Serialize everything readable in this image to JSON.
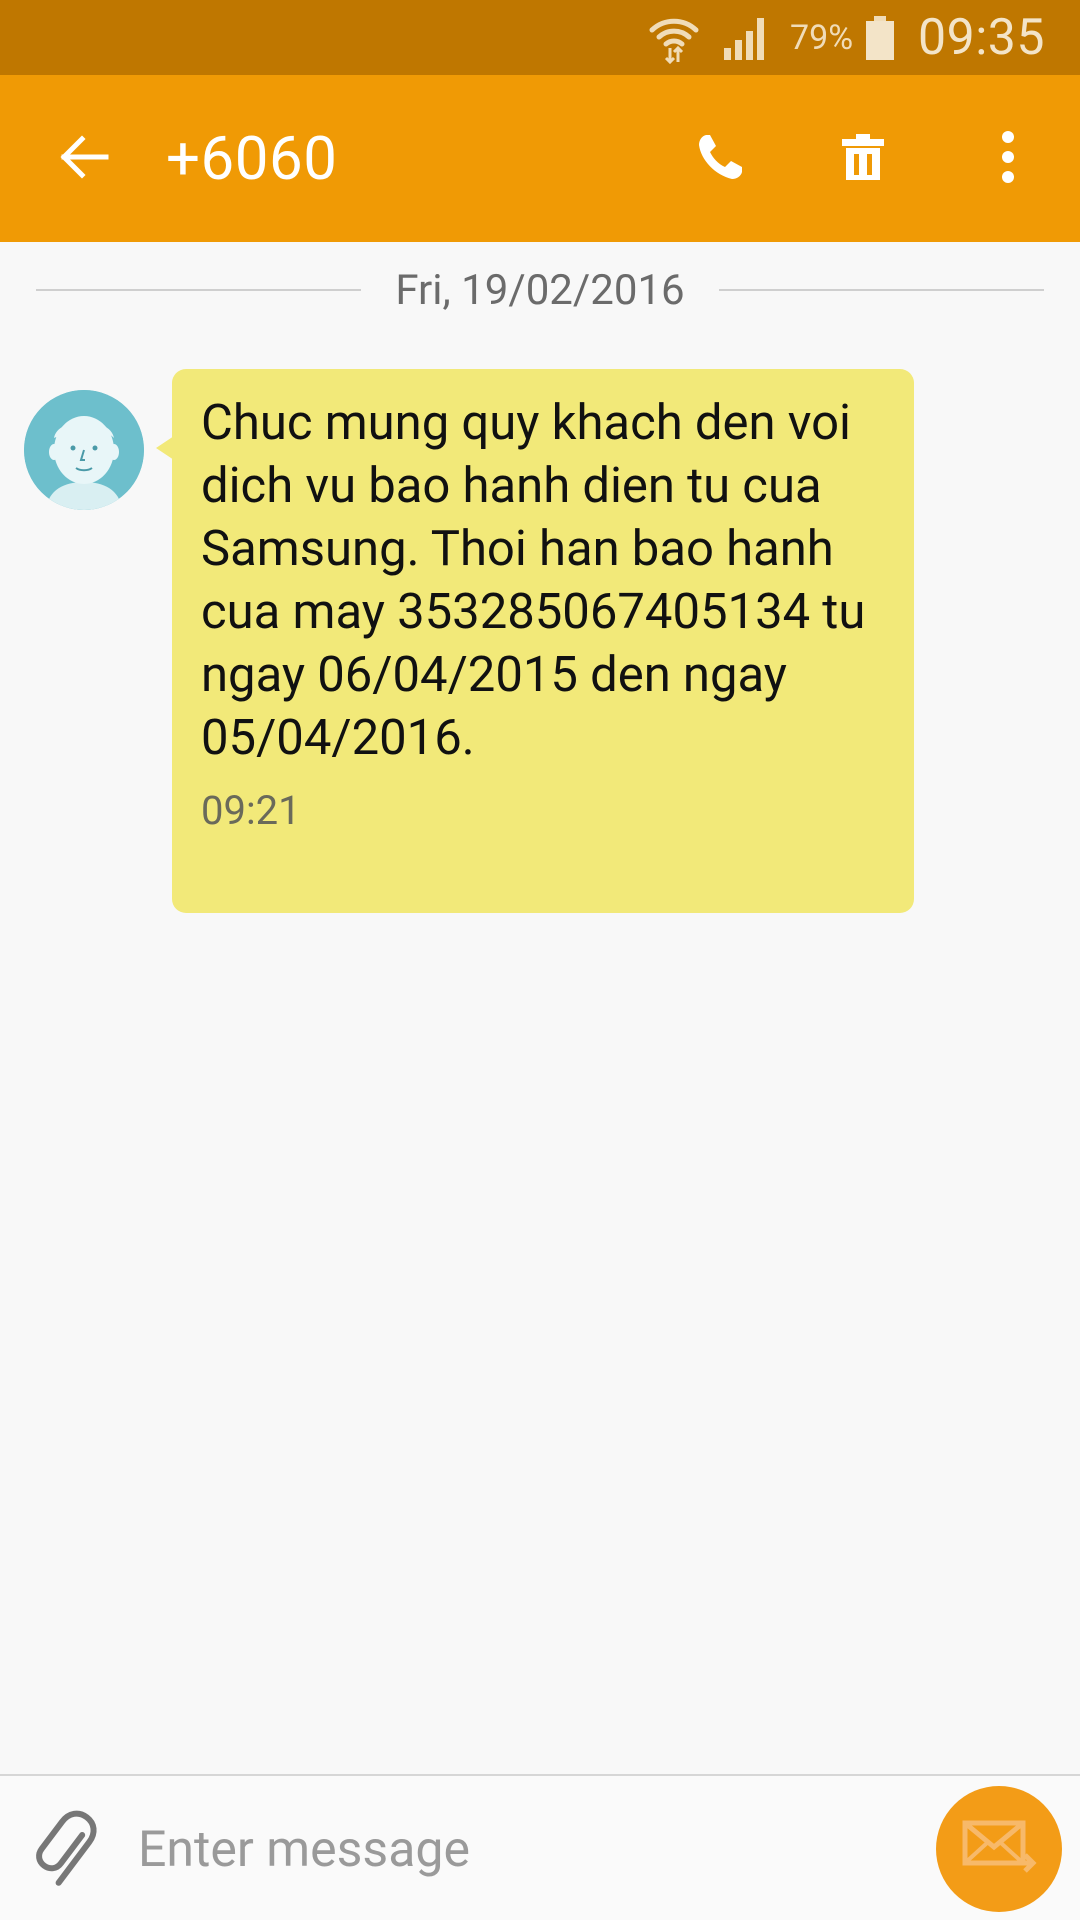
{
  "status_bar": {
    "battery_percent": "79%",
    "time": "09:35",
    "icons": [
      "wifi-icon",
      "signal-icon",
      "battery-icon"
    ]
  },
  "app_bar": {
    "title": "+6060",
    "icons": [
      "back-arrow-icon",
      "phone-icon",
      "trash-icon",
      "more-vert-icon"
    ]
  },
  "conversation": {
    "date": "Fri, 19/02/2016",
    "messages": [
      {
        "text": "Chuc mung quy khach den voi dich vu bao hanh dien tu cua Samsung. Thoi han bao hanh cua may 353285067405134 tu ngay 06/04/2015 den ngay 05/04/2016.",
        "time": "09:21",
        "direction": "incoming",
        "avatar_icon": "contact-avatar-icon"
      }
    ]
  },
  "composer": {
    "placeholder": "Enter message",
    "icons": [
      "paperclip-icon",
      "send-envelope-icon"
    ]
  },
  "colors": {
    "status_bar": "#bf7700",
    "app_bar": "#f09a05",
    "bubble": "#f2e979",
    "send_button": "#f39c17",
    "background": "#f8f8f8"
  }
}
